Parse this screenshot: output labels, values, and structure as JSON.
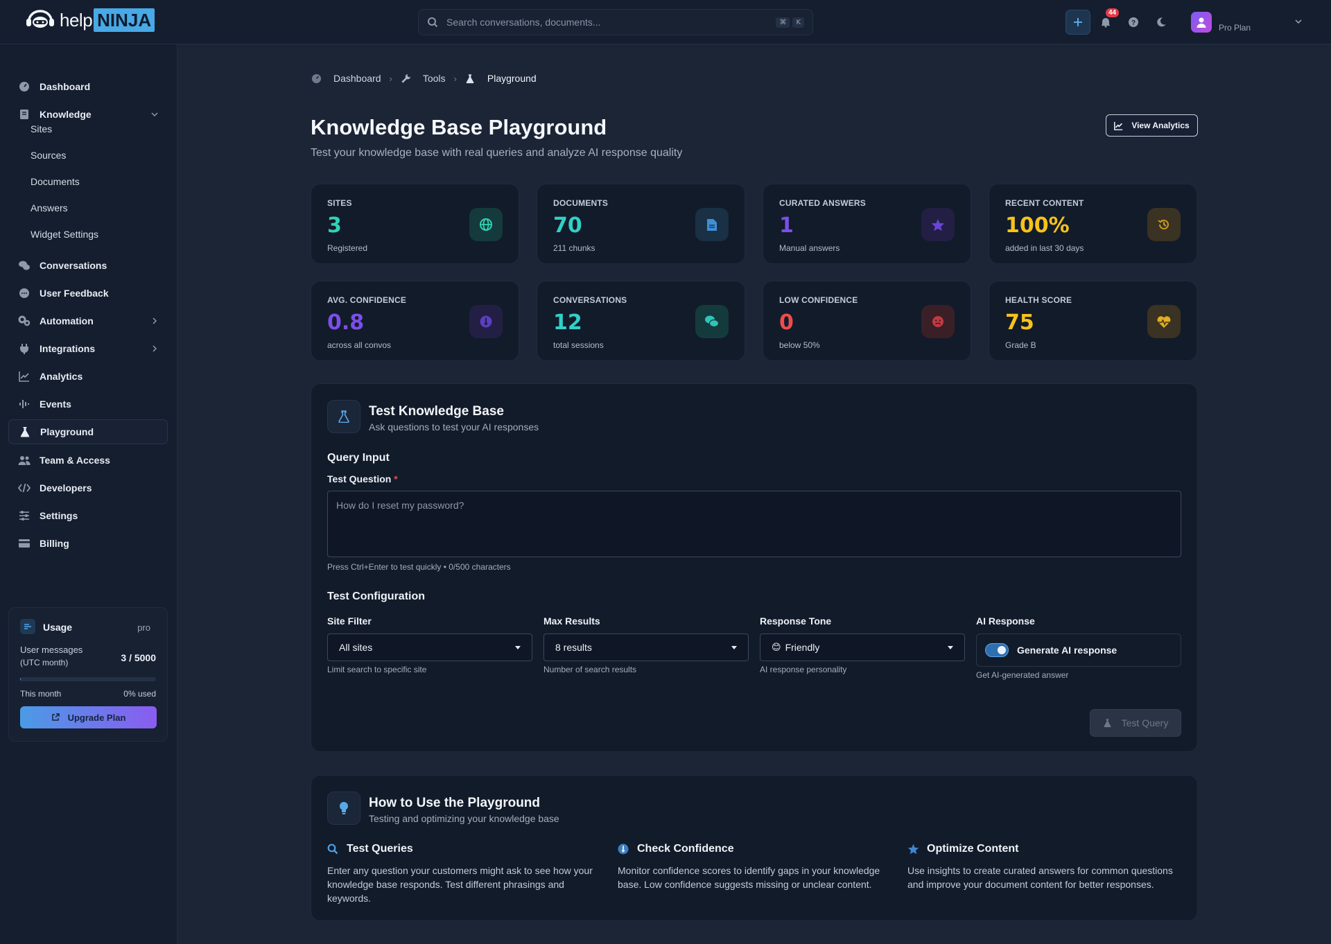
{
  "header": {
    "logo_help": "help",
    "logo_ninja": "NINJA",
    "search_placeholder": "Search conversations, documents...",
    "shortcut_key1": "⌘",
    "shortcut_key2": "K",
    "notification_count": "44",
    "plan_label": "Pro Plan"
  },
  "sidebar": {
    "items": [
      {
        "label": "Dashboard",
        "icon": "gauge-icon"
      },
      {
        "label": "Knowledge",
        "icon": "book-icon"
      },
      {
        "label": "Conversations",
        "icon": "chat-icon"
      },
      {
        "label": "User Feedback",
        "icon": "feedback-icon"
      },
      {
        "label": "Automation",
        "icon": "gears-icon"
      },
      {
        "label": "Integrations",
        "icon": "plug-icon"
      },
      {
        "label": "Analytics",
        "icon": "chart-line-icon"
      },
      {
        "label": "Events",
        "icon": "waveform-icon"
      },
      {
        "label": "Playground",
        "icon": "flask-icon"
      },
      {
        "label": "Team & Access",
        "icon": "users-icon"
      },
      {
        "label": "Developers",
        "icon": "code-icon"
      },
      {
        "label": "Settings",
        "icon": "sliders-icon"
      },
      {
        "label": "Billing",
        "icon": "credit-card-icon"
      }
    ],
    "knowledge_sub": [
      "Sites",
      "Sources",
      "Documents",
      "Answers",
      "Widget Settings"
    ],
    "active_item": "Playground"
  },
  "usage": {
    "title": "Usage",
    "plan": "pro",
    "label_line1": "User messages",
    "label_line2": "(UTC month)",
    "count": "3 / 5000",
    "progress_fraction": 0.0006,
    "period": "This month",
    "used": "0% used",
    "upgrade_label": "Upgrade Plan"
  },
  "breadcrumb": {
    "items": [
      "Dashboard",
      "Tools",
      "Playground"
    ]
  },
  "page": {
    "title": "Knowledge Base Playground",
    "subtitle": "Test your knowledge base with real queries and analyze AI response quality",
    "analytics_button": "View Analytics"
  },
  "stats": [
    {
      "label": "SITES",
      "value": "3",
      "caption": "Registered",
      "color": "#2fd3b5",
      "icon": "globe-icon"
    },
    {
      "label": "DOCUMENTS",
      "value": "70",
      "caption": "211 chunks",
      "color": "#31d0c6",
      "icon": "document-icon"
    },
    {
      "label": "CURATED ANSWERS",
      "value": "1",
      "caption": "Manual answers",
      "color": "#7b4fe8",
      "icon": "star-icon"
    },
    {
      "label": "RECENT CONTENT",
      "value": "100%",
      "caption": "added in last 30 days",
      "color": "#f6c21b",
      "icon": "history-icon"
    },
    {
      "label": "AVG. CONFIDENCE",
      "value": "0.8",
      "caption": "across all convos",
      "color": "#7b4fe8",
      "icon": "thermometer-icon"
    },
    {
      "label": "CONVERSATIONS",
      "value": "12",
      "caption": "total sessions",
      "color": "#31d0c6",
      "icon": "chat-bubbles-icon"
    },
    {
      "label": "LOW CONFIDENCE",
      "value": "0",
      "caption": "below 50%",
      "color": "#ee4c4c",
      "icon": "frown-icon"
    },
    {
      "label": "HEALTH SCORE",
      "value": "75",
      "caption": "Grade B",
      "color": "#f6c21b",
      "icon": "heart-pulse-icon"
    }
  ],
  "test_panel": {
    "title": "Test Knowledge Base",
    "subtitle": "Ask questions to test your AI responses",
    "query_section": "Query Input",
    "question_label": "Test Question",
    "required_mark": "*",
    "question_placeholder": "How do I reset my password?",
    "question_hint": "Press Ctrl+Enter to test quickly • 0/500 characters",
    "config_section": "Test Configuration",
    "site_filter": {
      "label": "Site Filter",
      "value": "All sites",
      "hint": "Limit search to specific site"
    },
    "max_results": {
      "label": "Max Results",
      "value": "8 results",
      "hint": "Number of search results"
    },
    "response_tone": {
      "label": "Response Tone",
      "value": "Friendly",
      "emoji": "😊",
      "hint": "AI response personality"
    },
    "ai_response": {
      "label": "AI Response",
      "toggle_label": "Generate AI response",
      "enabled": true,
      "hint": "Get AI-generated answer"
    },
    "test_button": "Test Query"
  },
  "howto_panel": {
    "title": "How to Use the Playground",
    "subtitle": "Testing and optimizing your knowledge base",
    "tips": [
      {
        "title": "Test Queries",
        "icon": "search-icon",
        "body": "Enter any question your customers might ask to see how your knowledge base responds. Test different phrasings and keywords."
      },
      {
        "title": "Check Confidence",
        "icon": "thermometer-icon",
        "body": "Monitor confidence scores to identify gaps in your knowledge base. Low confidence suggests missing or unclear content."
      },
      {
        "title": "Optimize Content",
        "icon": "star-icon",
        "body": "Use insights to create curated answers for common questions and improve your document content for better responses."
      }
    ]
  },
  "colors": {
    "accent": "#48a9e6",
    "background": "#1b2536",
    "card": "#121b2a",
    "danger": "#e53946"
  }
}
